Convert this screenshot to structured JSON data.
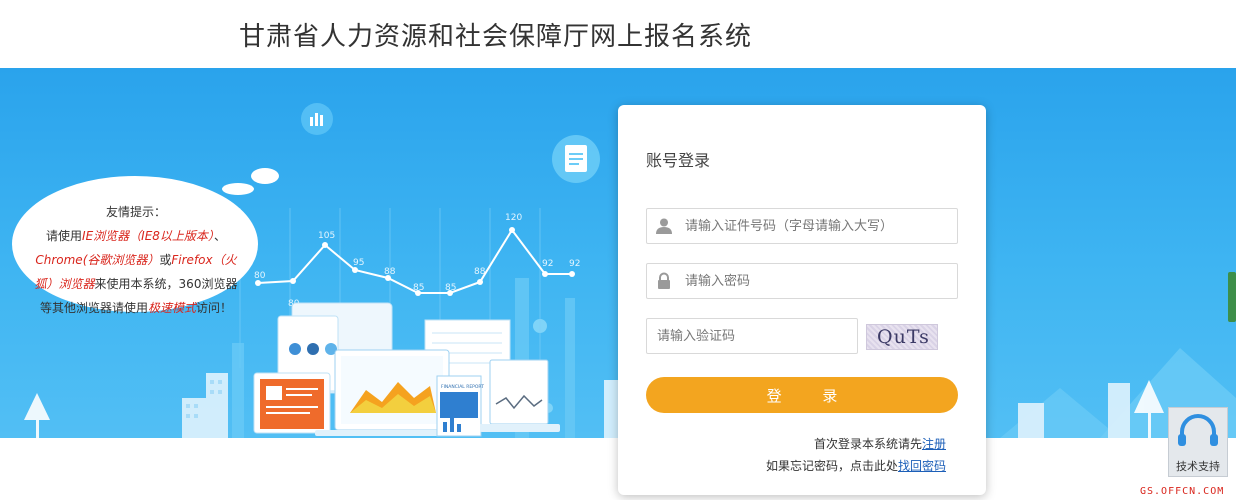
{
  "header": {
    "title": "甘肃省人力资源和社会保障厅网上报名系统"
  },
  "tip": {
    "heading": "友情提示：",
    "line1_a": "请使用",
    "line1_red": "IE浏览器（IE8以上版本）",
    "line1_b": "、",
    "line2_red": "Chrome(谷歌浏览器）",
    "line2_b": "或",
    "line2_red2": "Firefox（火",
    "line3_red": "狐）浏览器",
    "line3_b": "来使用本系统，360浏览器",
    "line4_a": "等其他浏览器请使用",
    "line4_red": "极速模式",
    "line4_b": "访问！"
  },
  "chart_labels": [
    "80",
    "80",
    "105",
    "95",
    "88",
    "85",
    "85",
    "88",
    "120",
    "92",
    "92"
  ],
  "illustration": {
    "report_caption": "FINANCIAL REPORT"
  },
  "login": {
    "title": "账号登录",
    "id_placeholder": "请输入证件号码（字母请输入大写）",
    "password_placeholder": "请输入密码",
    "captcha_placeholder": "请输入验证码",
    "captcha_text": "QuTs",
    "submit_label": "登  录",
    "register_prompt": "首次登录本系统请先",
    "register_link": "注册",
    "forgot_prompt": "如果忘记密码，点击此处",
    "forgot_link": "找回密码"
  },
  "support": {
    "label": "技术支持"
  },
  "watermark": "GS.OFFCN.COM",
  "colors": {
    "banner": "#3fb5f2",
    "button": "#f3a51f",
    "link": "#1c5fb8",
    "tip_red": "#d9251c"
  }
}
